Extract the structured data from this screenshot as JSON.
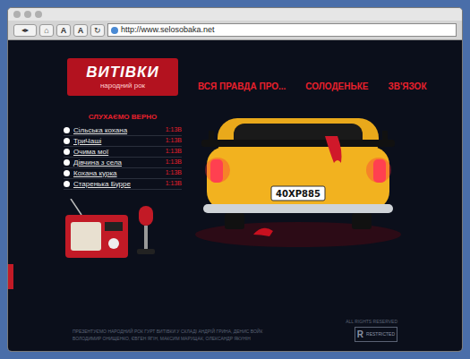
{
  "browser": {
    "url": "http://www.selosobaka.net",
    "buttons": [
      "A",
      "A"
    ]
  },
  "logo": {
    "title": "ВИТІВКИ",
    "subtitle": "народний рок"
  },
  "nav": [
    {
      "label": "ВСЯ ПРАВДА ПРО..."
    },
    {
      "label": "СОЛОДЕНЬКЕ"
    },
    {
      "label": "ЗВ'ЯЗОК"
    }
  ],
  "playlist": {
    "title": "СЛУХАЄМО ВЕРНО",
    "tracks": [
      {
        "name": "Сільська кохана",
        "time": "1:13В"
      },
      {
        "name": "ТриЧаші",
        "time": "1:13В"
      },
      {
        "name": "Очима мої",
        "time": "1:13В"
      },
      {
        "name": "Дівчина з села",
        "time": "1:13В"
      },
      {
        "name": "Кохана курка",
        "time": "1:13В"
      },
      {
        "name": "Старенька Бурре",
        "time": "1:13В"
      }
    ]
  },
  "car": {
    "plate": "40XP885"
  },
  "footer": {
    "credits": [
      "ПРЕЗЕНТУЄМО НАРОДНИЙ РОК ГУРТ ВИТІВКИ У СКЛАДІ АНДРІЙ ГРИНА, ДЕНИС ВОЙК",
      "ВОЛОДИМИР ОНИЩЕНКО, ЄВГЕН ЯГІН, МАКСИМ МАРУЩАК, ОЛЕКСАНДР ЯКУНІН"
    ],
    "rating": "R",
    "rating_note": "RESTRICTED",
    "rights": "ALL RIGHTS RESERVED"
  }
}
